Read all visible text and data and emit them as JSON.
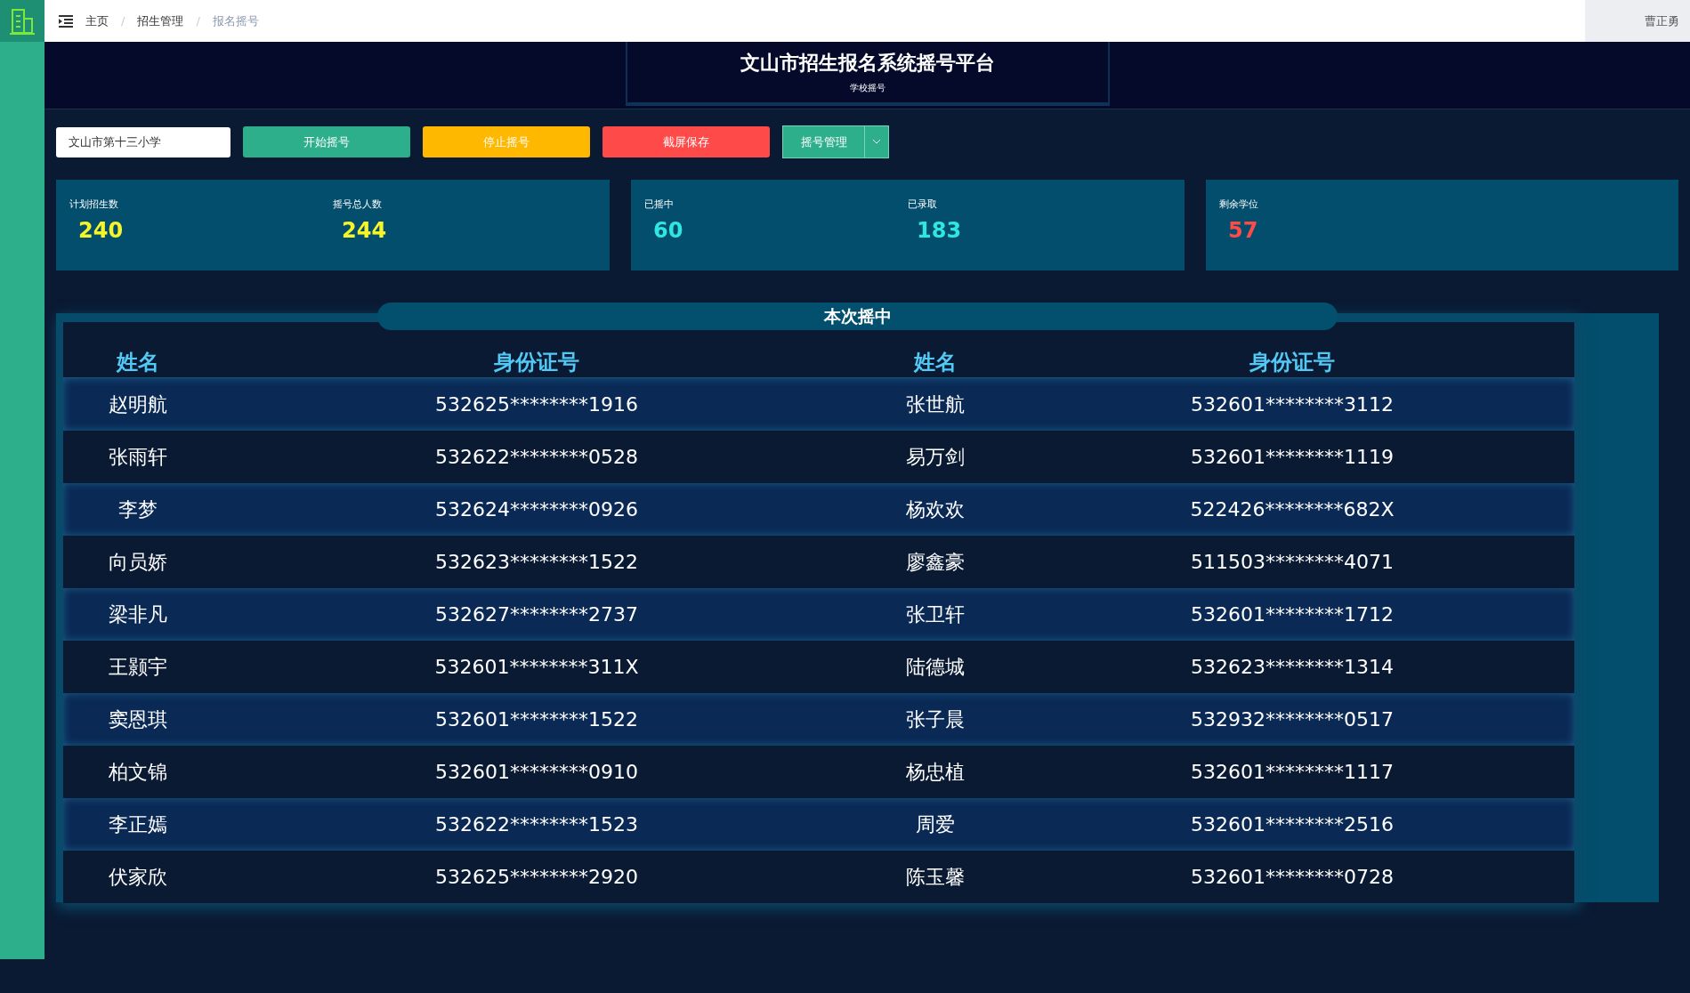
{
  "breadcrumb": {
    "items": [
      "主页",
      "招生管理",
      "报名摇号"
    ],
    "separator": "/"
  },
  "user": {
    "name": "曹正勇"
  },
  "header": {
    "title": "文山市招生报名系统摇号平台",
    "subtitle": "学校摇号"
  },
  "controls": {
    "school_select": "文山市第十三小学",
    "buttons": [
      {
        "label": "开始摇号",
        "kind": "start"
      },
      {
        "label": "停止摇号",
        "kind": "stop"
      },
      {
        "label": "截屏保存",
        "kind": "save"
      }
    ],
    "dropdown_button": "摇号管理"
  },
  "stat_cards": [
    {
      "stats": [
        {
          "label": "计划招生数",
          "value": "240",
          "color": "#f5f52a"
        },
        {
          "label": "摇号总人数",
          "value": "244",
          "color": "#f5f52a"
        }
      ]
    },
    {
      "stats": [
        {
          "label": "已摇中",
          "value": "60",
          "color": "#2ee8e0"
        },
        {
          "label": "已录取",
          "value": "183",
          "color": "#2ee8e0"
        }
      ]
    },
    {
      "stats": [
        {
          "label": "剩余学位",
          "value": "57",
          "color": "#ff4a4a"
        }
      ]
    }
  ],
  "table": {
    "title": "本次摇中",
    "columns": [
      "姓名",
      "身份证号",
      "姓名",
      "身份证号"
    ],
    "rows": [
      [
        "赵明航",
        "532625********1916",
        "张世航",
        "532601********3112"
      ],
      [
        "张雨轩",
        "532622********0528",
        "易万剑",
        "532601********1119"
      ],
      [
        "李梦",
        "532624********0926",
        "杨欢欢",
        "522426********682X"
      ],
      [
        "向员娇",
        "532623********1522",
        "廖鑫豪",
        "511503********4071"
      ],
      [
        "梁非凡",
        "532627********2737",
        "张卫轩",
        "532601********1712"
      ],
      [
        "王颢宇",
        "532601********311X",
        "陆德城",
        "532623********1314"
      ],
      [
        "窦恩琪",
        "532601********1522",
        "张子晨",
        "532932********0517"
      ],
      [
        "柏文锦",
        "532601********0910",
        "杨忠植",
        "532601********1117"
      ],
      [
        "李正嫣",
        "532622********1523",
        "周爱",
        "532601********2516"
      ],
      [
        "伏家欣",
        "532625********2920",
        "陈玉馨",
        "532601********0728"
      ]
    ]
  }
}
